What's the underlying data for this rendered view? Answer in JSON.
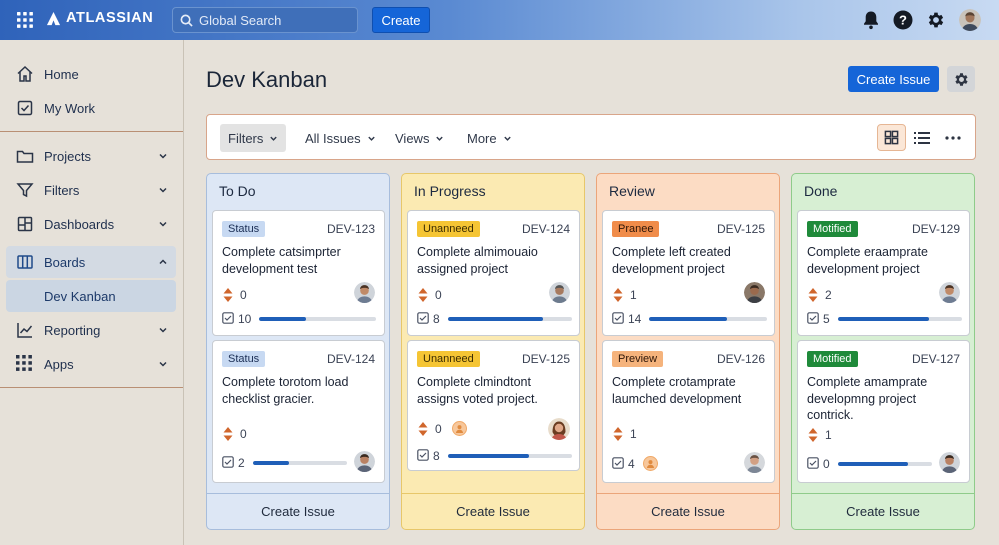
{
  "topbar": {
    "brand": "ATLASSIAN",
    "search_placeholder": "Global Search",
    "create_label": "Create"
  },
  "sidebar": {
    "items": [
      {
        "label": "Home"
      },
      {
        "label": "My Work"
      },
      {
        "label": "Projects"
      },
      {
        "label": "Filters"
      },
      {
        "label": "Dashboards"
      },
      {
        "label": "Boards"
      },
      {
        "label": "Dev Kanban"
      },
      {
        "label": "Reporting"
      },
      {
        "label": "Apps"
      }
    ]
  },
  "page": {
    "title": "Dev Kanban",
    "create_issue_label": "Create Issue"
  },
  "filters": {
    "filters_label": "Filters",
    "all_issues_label": "All Issues",
    "views_label": "Views",
    "more_label": "More"
  },
  "colors": {
    "accent": "#1565d8",
    "todo_bg": "#dde7f5",
    "progress_bg": "#fbeab2",
    "review_bg": "#fcdcc4",
    "done_bg": "#d7efd3"
  },
  "columns": [
    {
      "title": "To Do",
      "footer": "Create Issue",
      "cards": [
        {
          "badge": "Status",
          "key": "DEV-123",
          "title": "Complete catsimprter development test",
          "priority": "0",
          "checks": "10",
          "progress": 0.4
        },
        {
          "badge": "Status",
          "key": "DEV-124",
          "title": "Complete torotom load checklist gracier.",
          "priority": "0",
          "checks": "2",
          "progress": 0.38
        }
      ]
    },
    {
      "title": "In Progress",
      "footer": "Create Issue",
      "cards": [
        {
          "badge": "Unanneed",
          "key": "DEV-124",
          "title": "Complete almimouaio assigned project",
          "priority": "0",
          "checks": "8",
          "progress": 0.77
        },
        {
          "badge": "Unanneed",
          "key": "DEV-125",
          "title": "Complete clmindtont assigns voted project.",
          "priority": "0",
          "checks": "8",
          "progress": 0.65
        }
      ]
    },
    {
      "title": "Review",
      "footer": "Create Issue",
      "cards": [
        {
          "badge": "Pranee",
          "key": "DEV-125",
          "title": "Complete left created development project",
          "priority": "1",
          "checks": "14",
          "progress": 0.66
        },
        {
          "badge": "Preview",
          "key": "DEV-126",
          "title": "Complete crotamprate laumched development",
          "priority": "1",
          "checks": "4",
          "progress": 0
        }
      ]
    },
    {
      "title": "Done",
      "footer": "Create Issue",
      "cards": [
        {
          "badge": "Motified",
          "key": "DEV-129",
          "title": "Complete eraamprate development project",
          "priority": "2",
          "checks": "5",
          "progress": 0.73
        },
        {
          "badge": "Motified",
          "key": "DEV-127",
          "title": "Complete amamprate developmng project contrick.",
          "priority": "1",
          "checks": "0",
          "progress": 0.74
        }
      ]
    }
  ]
}
